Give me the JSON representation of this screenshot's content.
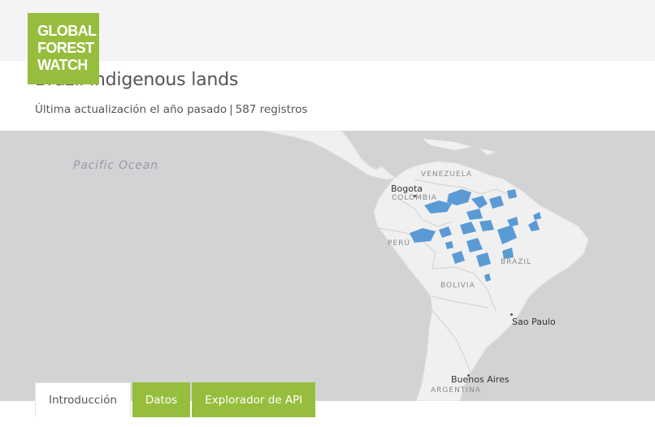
{
  "logo": {
    "lines": [
      "GLOBAL",
      "FOREST",
      "WATCH"
    ]
  },
  "dataset": {
    "title": "Brazil indigenous lands",
    "updated": "Última actualización el año pasado",
    "separator": "|",
    "records": "587 registros"
  },
  "map": {
    "ocean_label": "Pacific Ocean",
    "countries": [
      "VENEZUELA",
      "COLOMBIA",
      "PERÚ",
      "BRAZIL",
      "BOLIVIA",
      "ARGENTINA"
    ],
    "cities": [
      "Bogota",
      "Sao Paulo",
      "Buenos Aires"
    ],
    "colors": {
      "ocean": "#d3d3d6",
      "land": "#f0f0f0",
      "layer": "#5b9bd5"
    }
  },
  "tabs": [
    {
      "label": "Introducción",
      "active": true
    },
    {
      "label": "Datos",
      "active": false
    },
    {
      "label": "Explorador de API",
      "active": false
    }
  ],
  "colors": {
    "brand_green": "#97bd3d",
    "header_bg": "#f4f4f4",
    "text": "#555555"
  }
}
